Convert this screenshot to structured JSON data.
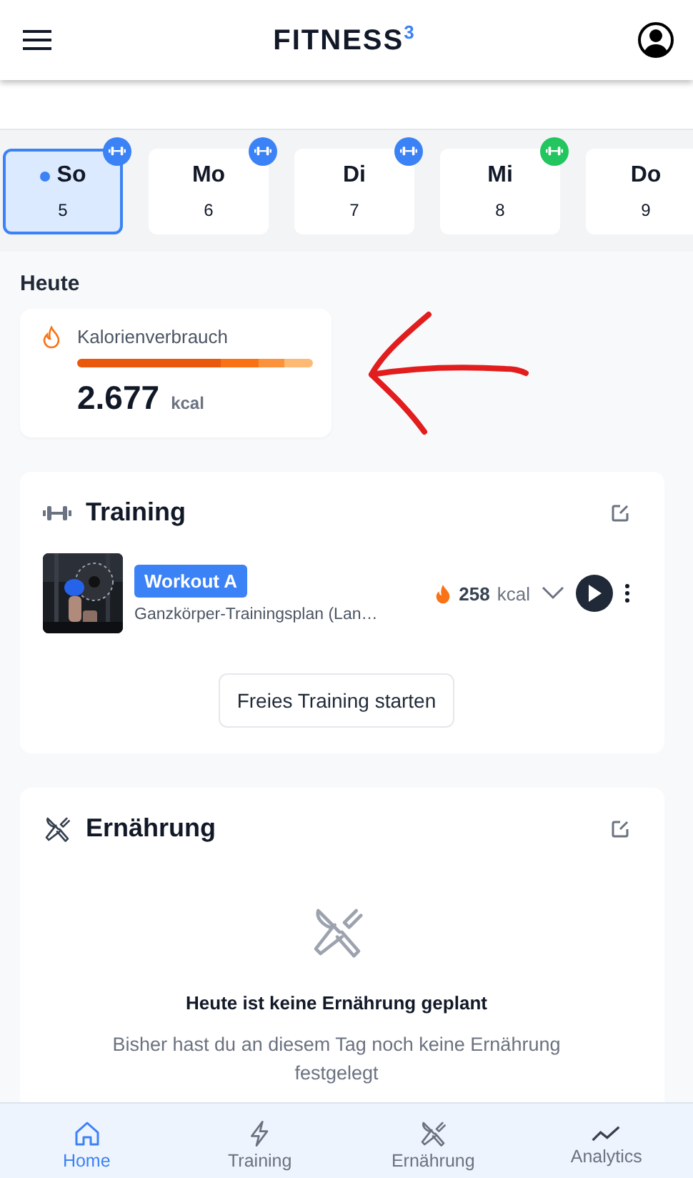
{
  "header": {
    "title": "FITNESS",
    "title_sup": "3"
  },
  "days": [
    {
      "label": "So",
      "date": "5",
      "selected": true,
      "color": "#3b82f6"
    },
    {
      "label": "Mo",
      "date": "6",
      "selected": false,
      "color": "#3b82f6"
    },
    {
      "label": "Di",
      "date": "7",
      "selected": false,
      "color": "#3b82f6"
    },
    {
      "label": "Mi",
      "date": "8",
      "selected": false,
      "color": "#22c55e"
    },
    {
      "label": "Do",
      "date": "9",
      "selected": false
    }
  ],
  "today": {
    "heading": "Heute",
    "calories": {
      "label": "Kalorienverbrauch",
      "value": "2.677",
      "unit": "kcal"
    }
  },
  "training": {
    "title": "Training",
    "workouts": [
      {
        "kind": "picture",
        "name": "Workout A",
        "plan": "Ganzkörper-Trainingsplan (Lan…",
        "kcal": "258",
        "unit": "kcal"
      }
    ],
    "button": "Freies Training starten"
  },
  "nutrition": {
    "title": "Ernährung",
    "empty_title": "Heute ist keine Ernährung geplant",
    "empty_text": "Bisher hast du an diesem Tag noch keine Ernährung festgelegt"
  },
  "nav": [
    {
      "label": "Home",
      "selected": true
    },
    {
      "label": "Training",
      "selected": false
    },
    {
      "label": "Ernährung",
      "selected": false
    },
    {
      "label": "Analytics",
      "selected": false
    }
  ]
}
